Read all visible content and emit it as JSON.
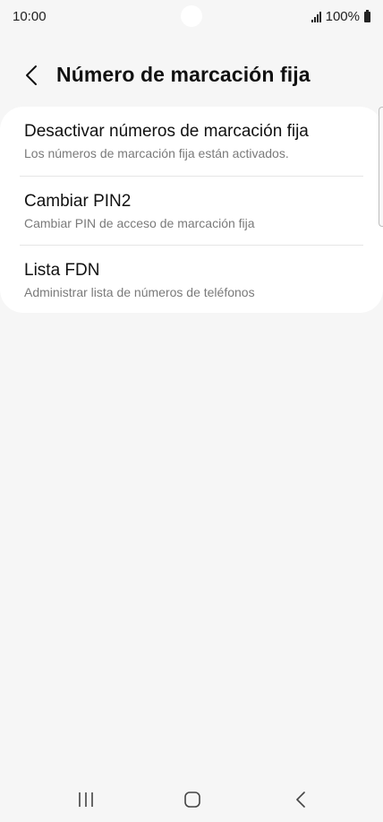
{
  "status_bar": {
    "time": "10:00",
    "battery": "100%"
  },
  "header": {
    "title": "Número de marcación fija"
  },
  "items": [
    {
      "title": "Desactivar números de marcación fija",
      "subtitle": "Los números de marcación fija están activados."
    },
    {
      "title": "Cambiar PIN2",
      "subtitle": "Cambiar PIN de acceso de marcación fija"
    },
    {
      "title": "Lista FDN",
      "subtitle": "Administrar lista de números de teléfonos"
    }
  ],
  "icons": {
    "back": "back-arrow-icon",
    "signal": "signal-icon",
    "battery": "battery-icon",
    "nav_recents": "recents-icon",
    "nav_home": "home-icon",
    "nav_back": "nav-back-icon"
  },
  "colors": {
    "background": "#f6f6f6",
    "card": "#ffffff",
    "title_text": "#111111",
    "subtitle_text": "#7a7a7a"
  }
}
